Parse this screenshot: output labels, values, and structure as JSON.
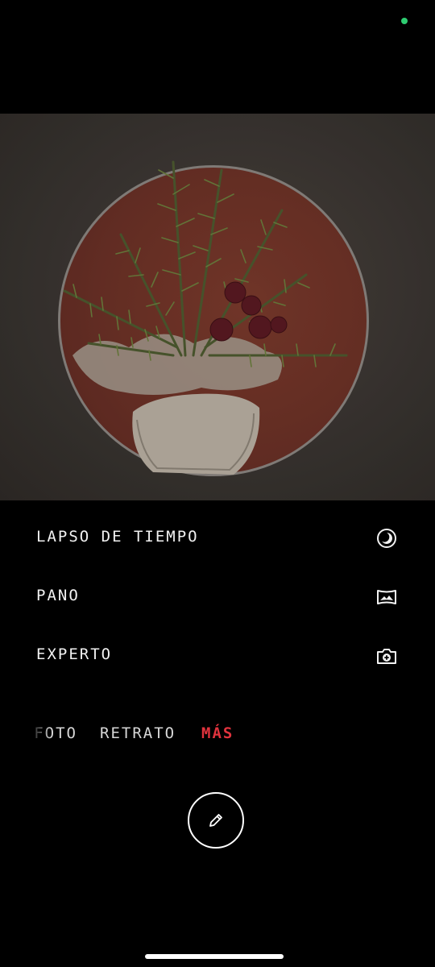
{
  "status": {
    "indicator_color": "#2ecc71"
  },
  "viewfinder": {
    "description_icon": "camera-preview"
  },
  "menu": {
    "items": [
      {
        "label": "LAPSO DE TIEMPO",
        "icon": "timelapse-icon"
      },
      {
        "label": "PANO",
        "icon": "panorama-icon"
      },
      {
        "label": "EXPERTO",
        "icon": "pro-camera-icon"
      }
    ]
  },
  "modes": {
    "items": [
      {
        "label": "FOTO",
        "selected": false
      },
      {
        "label": "RETRATO",
        "selected": false
      },
      {
        "label": "MÁS",
        "selected": true
      }
    ],
    "selected_color": "#e0333d"
  },
  "shutter": {
    "icon": "edit-pencil-icon"
  },
  "colors": {
    "background": "#000000",
    "text": "#f2f2f2",
    "accent": "#e0333d"
  }
}
